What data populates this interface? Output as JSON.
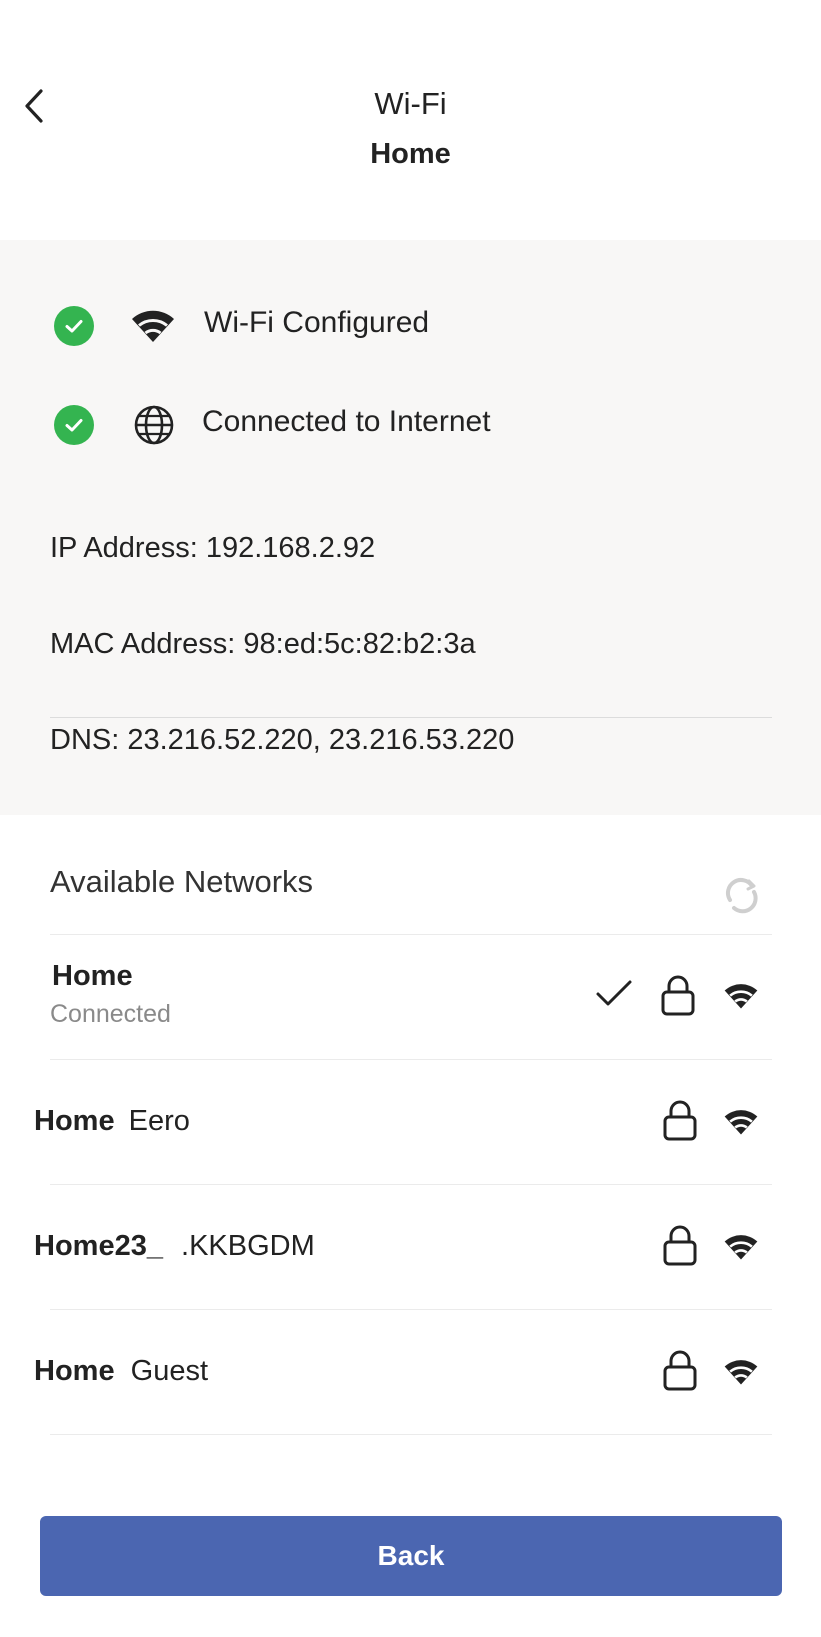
{
  "header": {
    "title": "Wi-Fi",
    "subtitle": "Home"
  },
  "status": {
    "items": [
      {
        "label": "Wi-Fi Configured",
        "icon": "wifi-icon",
        "state": "ok"
      },
      {
        "label": "Connected to Internet",
        "icon": "globe-icon",
        "state": "ok"
      }
    ],
    "ip_line": "IP Address: 192.168.2.92",
    "mac_line": "MAC Address: 98:ed:5c:82:b2:3a",
    "dns_line": "DNS: 23.216.52.220, 23.216.53.220"
  },
  "networks": {
    "header": "Available Networks",
    "items": [
      {
        "name_bold": "Home",
        "name_rest": "",
        "status": "Connected",
        "connected": true,
        "secured": true
      },
      {
        "name_bold": "Home",
        "name_rest": "Eero",
        "status": "",
        "connected": false,
        "secured": true
      },
      {
        "name_bold": "Home23_",
        "name_rest": ".KKBGDM",
        "status": "",
        "connected": false,
        "secured": true
      },
      {
        "name_bold": "Home",
        "name_rest": "Guest",
        "status": "",
        "connected": false,
        "secured": true
      }
    ]
  },
  "footer": {
    "back_label": "Back"
  },
  "colors": {
    "accent": "#4b66b1",
    "success": "#34b450",
    "panel_bg": "#f8f7f6"
  }
}
